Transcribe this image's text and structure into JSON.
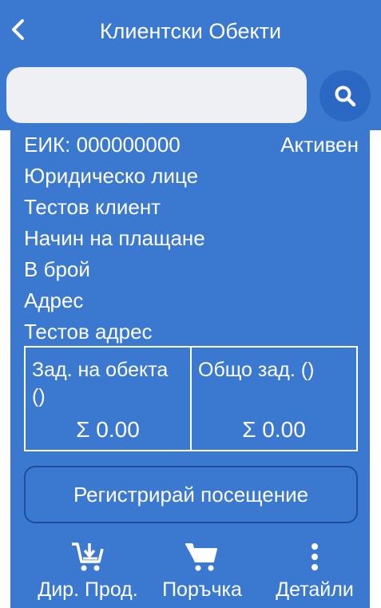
{
  "header": {
    "title": "Клиентски Обекти",
    "back_icon": "chevron-left-icon"
  },
  "search": {
    "value": "",
    "placeholder": "",
    "icon": "search-icon"
  },
  "client": {
    "eik": "ЕИК: 000000000",
    "status": "Активен",
    "entity_type": "Юридическо лице",
    "name": "Тестов клиент",
    "payment_label": "Начин на плащане",
    "payment_value": "В брой",
    "address_label": "Адрес",
    "address_value": "Тестов адрес"
  },
  "debts": {
    "site_label": "Зад. на обекта ()",
    "site_value": "Σ 0.00",
    "total_label": "Общо зад. ()",
    "total_value": "Σ 0.00"
  },
  "actions": {
    "register_visit": "Регистрирай посещение"
  },
  "nav": {
    "items": [
      {
        "label": "Дир. Прод.",
        "icon": "cart-download-icon"
      },
      {
        "label": "Поръчка",
        "icon": "cart-icon"
      },
      {
        "label": "Детайли",
        "icon": "more-vertical-icon"
      }
    ]
  },
  "colors": {
    "primary": "#3b78d0",
    "primary_dark": "#2b68c3",
    "border_dark": "#1d4f98",
    "search_bg": "#eef0f3",
    "text": "#ffffff"
  }
}
